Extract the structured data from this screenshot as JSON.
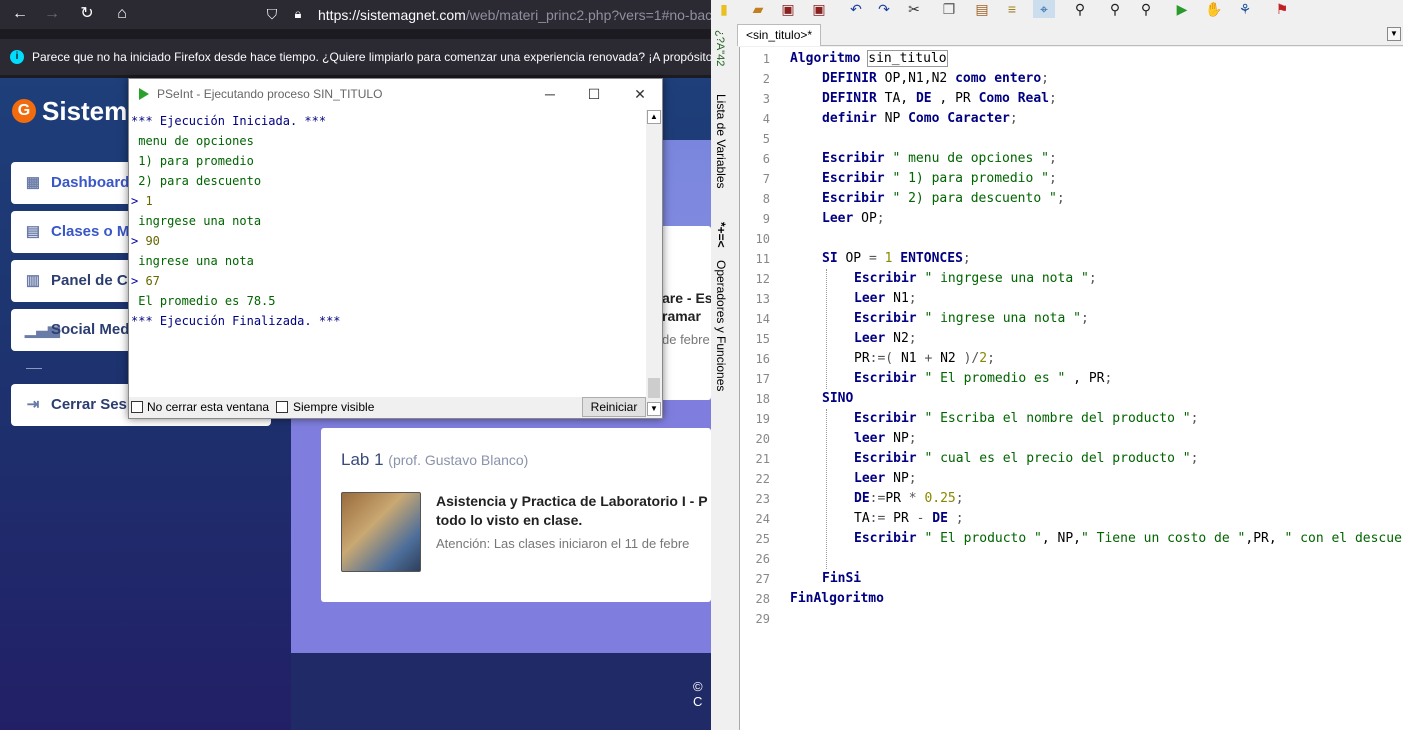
{
  "firefox": {
    "url_host": "https://sistemagnet.com",
    "url_path": "/web/materi_princ2.php?vers=1#no-back",
    "notice": "Parece que no ha iniciado Firefox desde hace tiempo. ¿Quiere limpiarlo para comenzar una experiencia renovada? ¡A propósito, b",
    "site": {
      "logo": "Sistem",
      "menu": [
        {
          "label": "Dashboard",
          "icon": "grid-icon"
        },
        {
          "label": "Clases o M",
          "icon": "book-icon"
        },
        {
          "label": "Panel de C",
          "icon": "panel-icon"
        },
        {
          "label": "Social Med",
          "icon": "chart-icon"
        },
        {
          "label": "Cerrar Ses",
          "icon": "logout-icon"
        }
      ],
      "behind_1": "are - Es",
      "behind_2": "ramar",
      "behind_3": "de febre",
      "lab": {
        "title": "Lab 1",
        "prof": "(prof. Gustavo Blanco)",
        "text_1": "Asistencia y Practica de Laboratorio I - P",
        "text_2": "todo lo visto en clase.",
        "sub": "Atención: Las clases iniciaron el 11 de febre"
      },
      "footer_copy": "© C"
    }
  },
  "run_window": {
    "title": "PSeInt - Ejecutando proceso SIN_TITULO",
    "console": [
      {
        "type": "sys",
        "text": "*** Ejecución Iniciada. ***"
      },
      {
        "type": "out",
        "text": " menu de opciones"
      },
      {
        "type": "out",
        "text": " 1) para promedio"
      },
      {
        "type": "out",
        "text": " 2) para descuento"
      },
      {
        "type": "in",
        "prompt": "> ",
        "text": "1"
      },
      {
        "type": "out",
        "text": " ingrgese una nota"
      },
      {
        "type": "in",
        "prompt": "> ",
        "text": "90"
      },
      {
        "type": "out",
        "text": " ingrese una nota"
      },
      {
        "type": "in",
        "prompt": "> ",
        "text": "67"
      },
      {
        "type": "out",
        "text": " El promedio es 78.5"
      },
      {
        "type": "sys",
        "text": "*** Ejecución Finalizada. ***"
      }
    ],
    "no_close_label": "No cerrar esta ventana",
    "always_visible_label": "Siempre visible",
    "restart_label": "Reiniciar"
  },
  "editor": {
    "tab_label": "<sin_titulo>*",
    "side_variables": "Lista de Variables",
    "side_operators": "Operadores y Funciones",
    "side_top_glyphs": "¿?A\"42",
    "side_mid_glyphs": "*+=<",
    "lines": [
      {
        "n": "1",
        "indent": 0,
        "tokens": [
          [
            "kw",
            "Algoritmo "
          ],
          [
            "ident hl",
            "sin_titulo"
          ]
        ]
      },
      {
        "n": "2",
        "indent": 1,
        "tokens": [
          [
            "kw",
            "DEFINIR "
          ],
          [
            "ident",
            "OP,N1,N2 "
          ],
          [
            "kw",
            "como entero"
          ],
          [
            "op",
            ";"
          ]
        ]
      },
      {
        "n": "3",
        "indent": 1,
        "tokens": [
          [
            "kw",
            "DEFINIR "
          ],
          [
            "ident",
            "TA, "
          ],
          [
            "kw",
            "DE"
          ],
          [
            "ident",
            " , PR "
          ],
          [
            "kw",
            "Como Real"
          ],
          [
            "op",
            ";"
          ]
        ]
      },
      {
        "n": "4",
        "indent": 1,
        "tokens": [
          [
            "kw",
            "definir "
          ],
          [
            "ident",
            "NP "
          ],
          [
            "kw",
            "Como Caracter"
          ],
          [
            "op",
            ";"
          ]
        ]
      },
      {
        "n": "5",
        "indent": 1,
        "tokens": []
      },
      {
        "n": "6",
        "indent": 1,
        "tokens": [
          [
            "kw",
            "Escribir "
          ],
          [
            "str",
            "\" menu de opciones \""
          ],
          [
            "op",
            ";"
          ]
        ]
      },
      {
        "n": "7",
        "indent": 1,
        "tokens": [
          [
            "kw",
            "Escribir "
          ],
          [
            "str",
            "\" 1) para promedio \""
          ],
          [
            "op",
            ";"
          ]
        ]
      },
      {
        "n": "8",
        "indent": 1,
        "tokens": [
          [
            "kw",
            "Escribir "
          ],
          [
            "str",
            "\" 2) para descuento \""
          ],
          [
            "op",
            ";"
          ]
        ]
      },
      {
        "n": "9",
        "indent": 1,
        "tokens": [
          [
            "kw",
            "Leer "
          ],
          [
            "ident",
            "OP"
          ],
          [
            "op",
            ";"
          ]
        ]
      },
      {
        "n": "10",
        "indent": 1,
        "tokens": []
      },
      {
        "n": "11",
        "indent": 1,
        "tokens": [
          [
            "kw",
            "SI "
          ],
          [
            "ident",
            "OP "
          ],
          [
            "op",
            "= "
          ],
          [
            "nm",
            "1 "
          ],
          [
            "kw",
            "ENTONCES"
          ],
          [
            "op",
            ";"
          ]
        ]
      },
      {
        "n": "12",
        "indent": 2,
        "tokens": [
          [
            "kw",
            "Escribir "
          ],
          [
            "str",
            "\" ingrgese una nota \""
          ],
          [
            "op",
            ";"
          ]
        ]
      },
      {
        "n": "13",
        "indent": 2,
        "tokens": [
          [
            "kw",
            "Leer "
          ],
          [
            "ident",
            "N1"
          ],
          [
            "op",
            ";"
          ]
        ]
      },
      {
        "n": "14",
        "indent": 2,
        "tokens": [
          [
            "kw",
            "Escribir "
          ],
          [
            "str",
            "\" ingrese una nota \""
          ],
          [
            "op",
            ";"
          ]
        ]
      },
      {
        "n": "15",
        "indent": 2,
        "tokens": [
          [
            "kw",
            "Leer "
          ],
          [
            "ident",
            "N2"
          ],
          [
            "op",
            ";"
          ]
        ]
      },
      {
        "n": "16",
        "indent": 2,
        "tokens": [
          [
            "ident",
            "PR"
          ],
          [
            "op",
            ":=( "
          ],
          [
            "ident",
            "N1 "
          ],
          [
            "op",
            "+ "
          ],
          [
            "ident",
            "N2 "
          ],
          [
            "op",
            ")/"
          ],
          [
            "nm",
            "2"
          ],
          [
            "op",
            ";"
          ]
        ]
      },
      {
        "n": "17",
        "indent": 2,
        "tokens": [
          [
            "kw",
            "Escribir "
          ],
          [
            "str",
            "\" El promedio es \""
          ],
          [
            "ident",
            " , PR"
          ],
          [
            "op",
            ";"
          ]
        ]
      },
      {
        "n": "18",
        "indent": 1,
        "tokens": [
          [
            "kw",
            "SINO"
          ]
        ]
      },
      {
        "n": "19",
        "indent": 2,
        "tokens": [
          [
            "kw",
            "Escribir "
          ],
          [
            "str",
            "\" Escriba el nombre del producto \""
          ],
          [
            "op",
            ";"
          ]
        ]
      },
      {
        "n": "20",
        "indent": 2,
        "tokens": [
          [
            "kw",
            "leer "
          ],
          [
            "ident",
            "NP"
          ],
          [
            "op",
            ";"
          ]
        ]
      },
      {
        "n": "21",
        "indent": 2,
        "tokens": [
          [
            "kw",
            "Escribir "
          ],
          [
            "str",
            "\" cual es el precio del producto \""
          ],
          [
            "op",
            ";"
          ]
        ]
      },
      {
        "n": "22",
        "indent": 2,
        "tokens": [
          [
            "kw",
            "Leer "
          ],
          [
            "ident",
            "NP"
          ],
          [
            "op",
            ";"
          ]
        ]
      },
      {
        "n": "23",
        "indent": 2,
        "tokens": [
          [
            "kw",
            "DE"
          ],
          [
            "op",
            ":="
          ],
          [
            "ident",
            "PR "
          ],
          [
            "op",
            "* "
          ],
          [
            "nm",
            "0.25"
          ],
          [
            "op",
            ";"
          ]
        ]
      },
      {
        "n": "24",
        "indent": 2,
        "tokens": [
          [
            "ident",
            "TA"
          ],
          [
            "op",
            ":= "
          ],
          [
            "ident",
            "PR "
          ],
          [
            "op",
            "- "
          ],
          [
            "kw",
            "DE"
          ],
          [
            "op",
            " ;"
          ]
        ]
      },
      {
        "n": "25",
        "indent": 2,
        "tokens": [
          [
            "kw",
            "Escribir "
          ],
          [
            "str",
            "\" El producto \""
          ],
          [
            "ident",
            ", NP,"
          ],
          [
            "str",
            "\" Tiene un costo de \""
          ],
          [
            "ident",
            ",PR, "
          ],
          [
            "str",
            "\" con el descuento de"
          ]
        ]
      },
      {
        "n": "26",
        "indent": 2,
        "tokens": []
      },
      {
        "n": "27",
        "indent": 1,
        "tokens": [
          [
            "kw",
            "FinSi"
          ]
        ]
      },
      {
        "n": "28",
        "indent": 0,
        "tokens": [
          [
            "kw",
            "FinAlgoritmo"
          ]
        ]
      },
      {
        "n": "29",
        "indent": 0,
        "tokens": []
      }
    ]
  },
  "colors": {
    "keyword": "#000080",
    "string": "#006400",
    "number": "#888800"
  }
}
